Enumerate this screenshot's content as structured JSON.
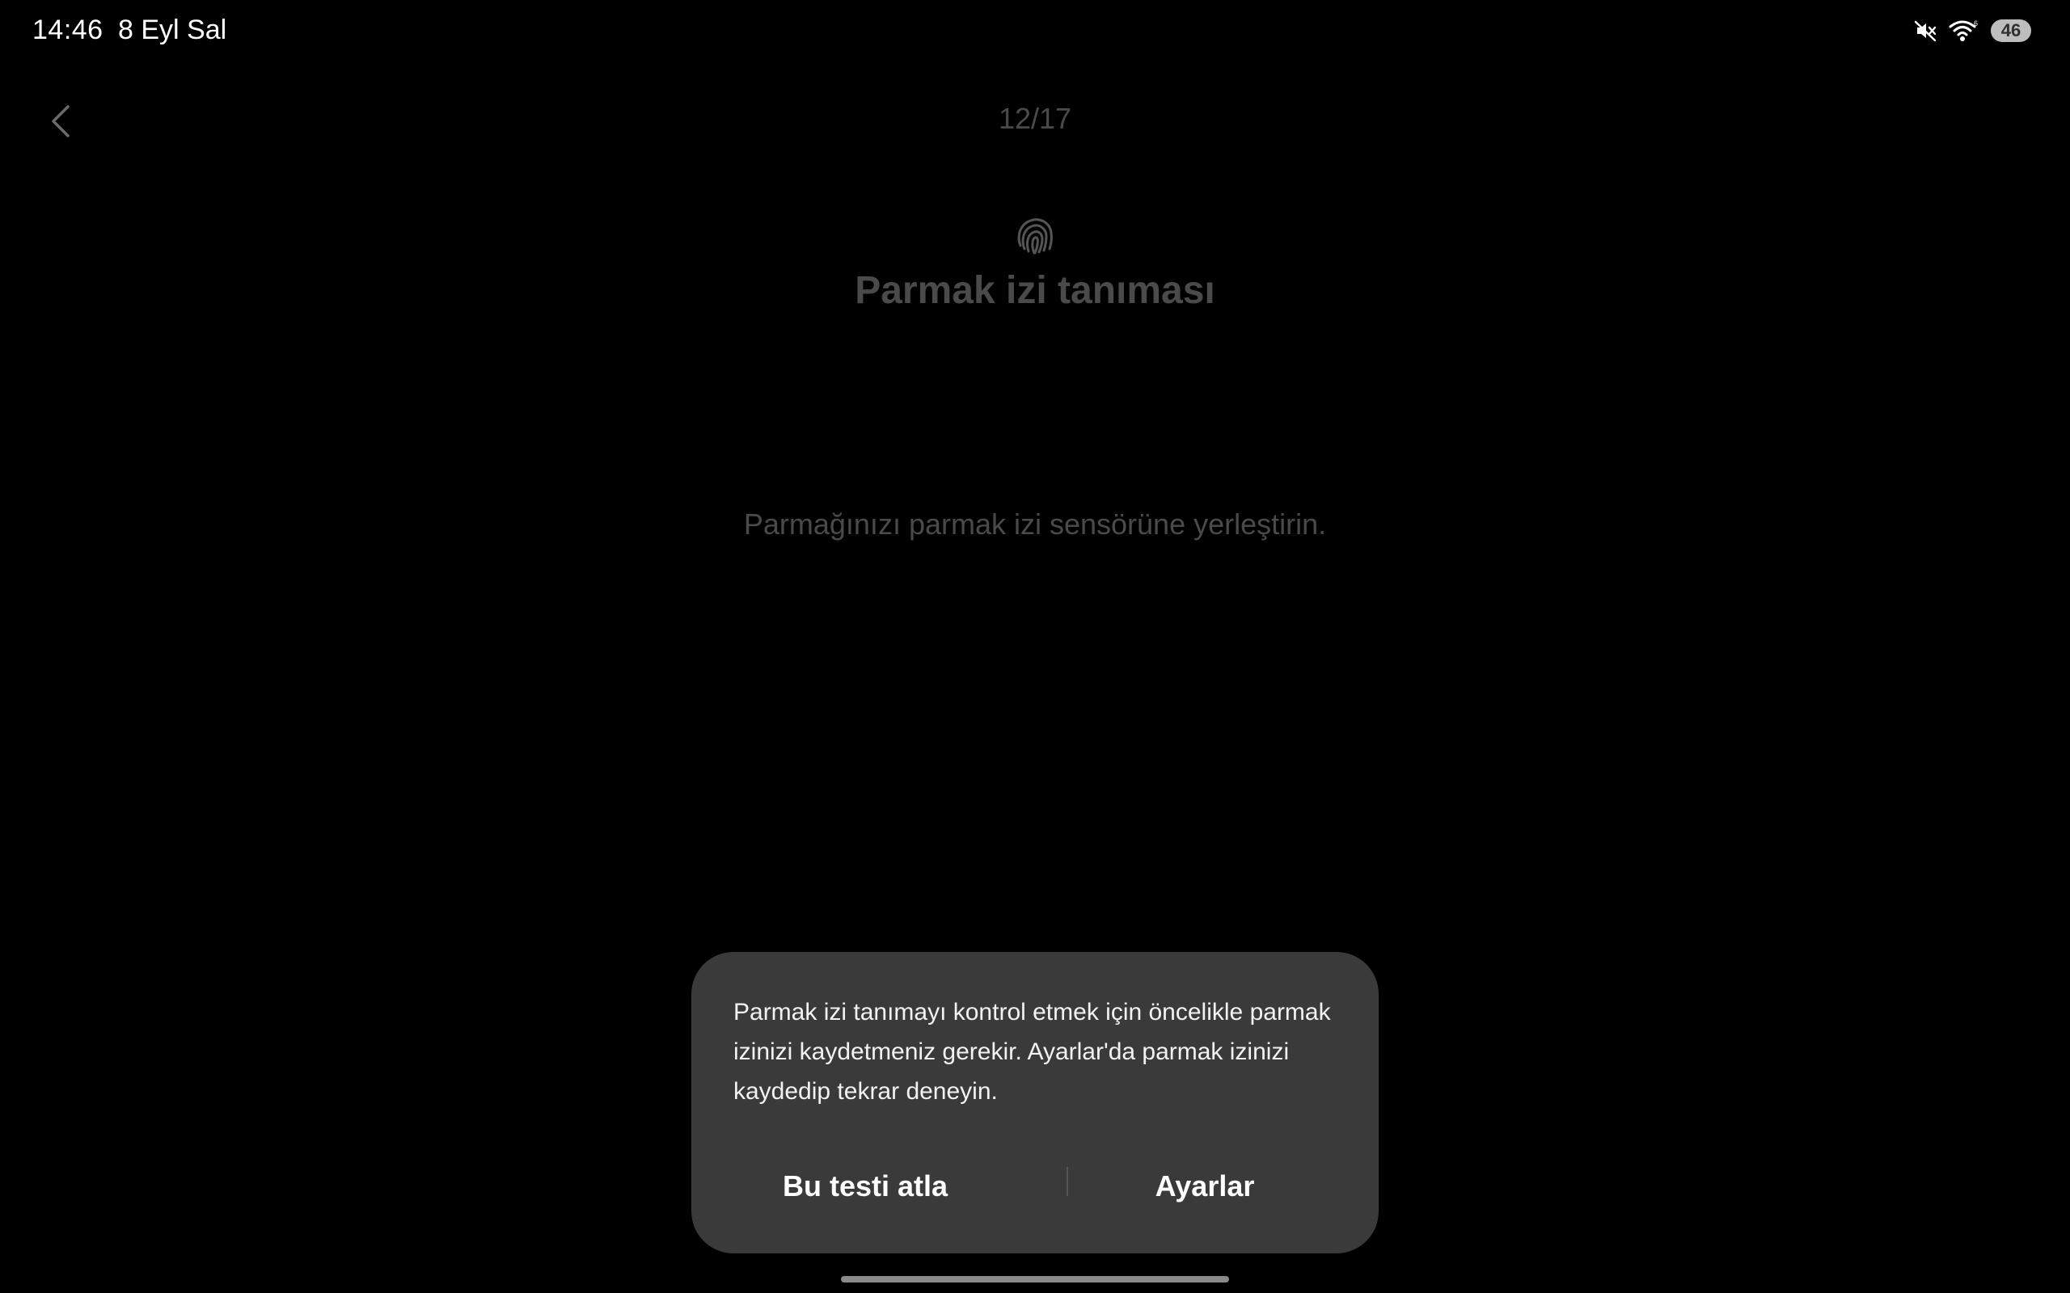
{
  "status_bar": {
    "time": "14:46",
    "date": "8 Eyl Sal",
    "battery": "46",
    "icons": [
      "mute-icon",
      "wifi-icon",
      "battery-icon"
    ]
  },
  "header": {
    "back_icon": "chevron-left-icon",
    "page_counter": "12/17"
  },
  "content": {
    "icon": "fingerprint-icon",
    "title": "Parmak izi tanıması",
    "instruction": "Parmağınızı parmak izi sensörüne yerleştirin."
  },
  "dialog": {
    "message": "Parmak izi tanımayı kontrol etmek için öncelikle parmak izinizi kaydetmeniz gerekir. Ayarlar'da parmak izinizi kaydedip tekrar deneyin.",
    "skip_label": "Bu testi atla",
    "settings_label": "Ayarlar"
  },
  "colors": {
    "background": "#000000",
    "dimmed_text": "#4a4a4a",
    "dialog_bg": "#3a3a3a"
  }
}
